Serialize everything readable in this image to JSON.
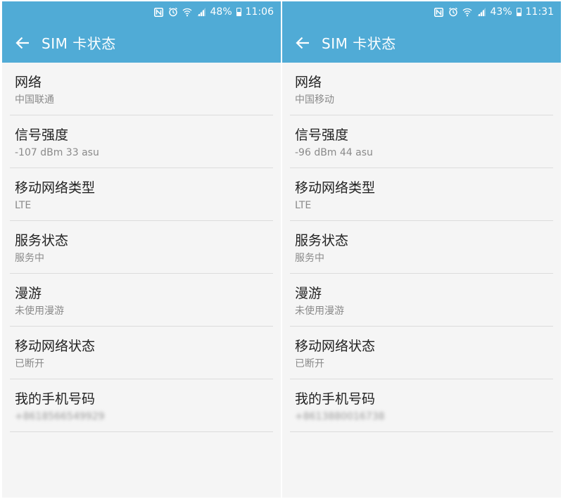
{
  "colors": {
    "accent": "#50abd6",
    "background": "#f5f5f5",
    "divider": "#dcdcdc"
  },
  "icons": [
    "nfc-icon",
    "alarm-icon",
    "wifi-icon",
    "signal-icon",
    "battery-icon",
    "back-arrow-icon"
  ],
  "screens": [
    {
      "status": {
        "battery": "48%",
        "time": "11:06",
        "battery_level": 0.48
      },
      "title": "SIM 卡状态",
      "items": [
        {
          "label": "网络",
          "value": "中国联通"
        },
        {
          "label": "信号强度",
          "value": "-107 dBm 33 asu"
        },
        {
          "label": "移动网络类型",
          "value": "LTE"
        },
        {
          "label": "服务状态",
          "value": "服务中"
        },
        {
          "label": "漫游",
          "value": "未使用漫游"
        },
        {
          "label": "移动网络状态",
          "value": "已断开"
        },
        {
          "label": "我的手机号码",
          "value": "+8618566549929"
        }
      ]
    },
    {
      "status": {
        "battery": "43%",
        "time": "11:31",
        "battery_level": 0.43
      },
      "title": "SIM 卡状态",
      "items": [
        {
          "label": "网络",
          "value": "中国移动"
        },
        {
          "label": "信号强度",
          "value": "-96 dBm 44 asu"
        },
        {
          "label": "移动网络类型",
          "value": "LTE"
        },
        {
          "label": "服务状态",
          "value": "服务中"
        },
        {
          "label": "漫游",
          "value": "未使用漫游"
        },
        {
          "label": "移动网络状态",
          "value": "已断开"
        },
        {
          "label": "我的手机号码",
          "value": "+8613880016738"
        }
      ]
    }
  ]
}
